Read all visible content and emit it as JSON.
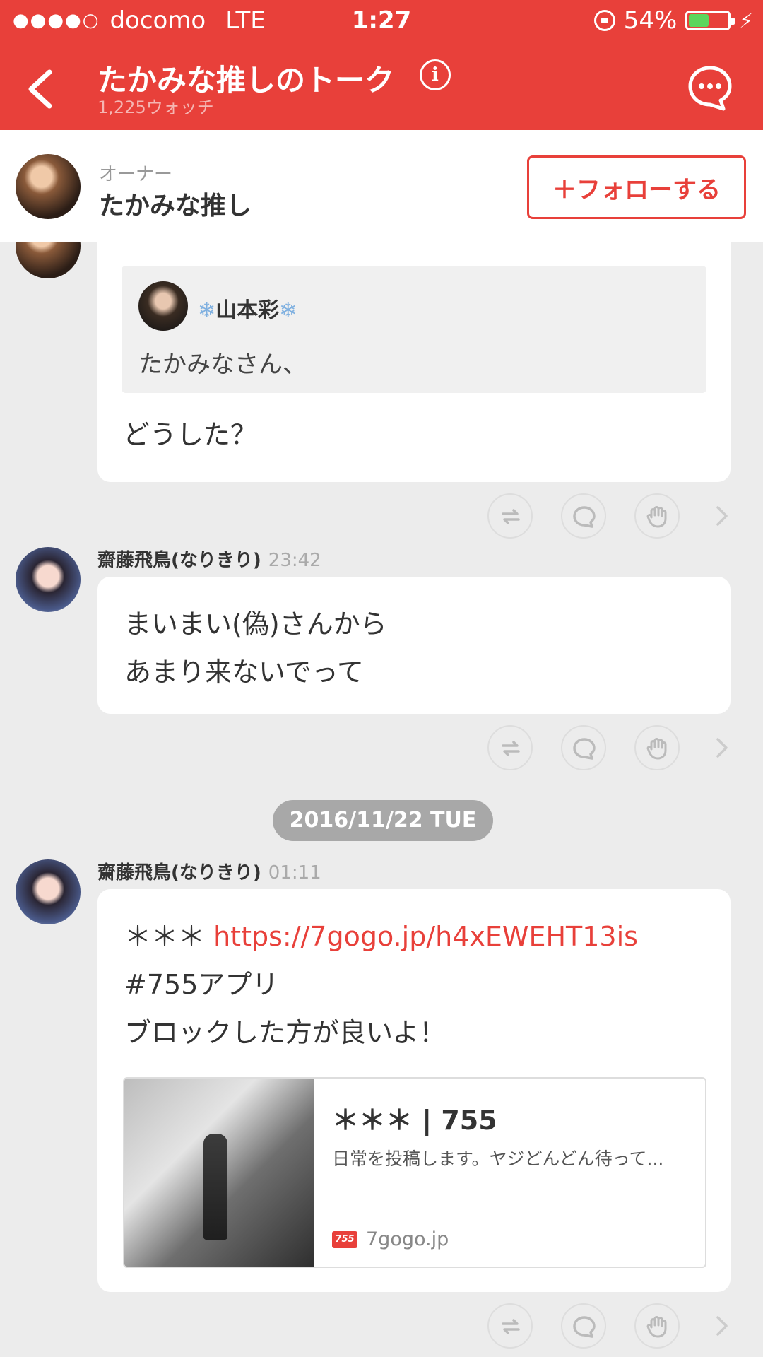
{
  "status_bar": {
    "signal": "●●●●○",
    "carrier": "docomo",
    "network": "LTE",
    "time": "1:27",
    "battery_percent": "54%",
    "battery_level": 0.54
  },
  "header": {
    "title": "たかみな推しのトーク",
    "watch_count": "1,225ウォッチ",
    "info_glyph": "i",
    "colors": {
      "brand": "#e8403a"
    }
  },
  "owner": {
    "role": "オーナー",
    "name": "たかみな推し",
    "follow_label": "＋フォローする"
  },
  "messages": [
    {
      "quote": {
        "name": "山本彩",
        "snow": "❄",
        "text": "たかみなさん、"
      },
      "lines": [
        "どうした？"
      ]
    },
    {
      "author": "齋藤飛鳥(なりきり)",
      "time": "23:42",
      "lines": [
        "まいまい(偽)さんから",
        "あまり来ないでって"
      ]
    },
    {
      "author": "齋藤飛鳥(なりきり)",
      "time": "01:11",
      "prefix": "＊＊＊ ",
      "link": "https://7gogo.jp/h4xEWEHT13is",
      "lines": [
        "#755アプリ",
        "ブロックした方が良いよ！"
      ],
      "card": {
        "title": "＊＊＊ | 755",
        "description": "日常を投稿します。ヤジどんどん待って...",
        "site": "7gogo.jp",
        "site_icon_text": "755"
      }
    }
  ],
  "date_separator": "2016/11/22 TUE",
  "icons": {
    "back": "chevron-left-icon",
    "chat": "chat-bubble-icon",
    "repost": "repost-icon",
    "reply": "reply-icon",
    "clap": "clap-hand-icon",
    "more": "chevron-right-icon"
  }
}
